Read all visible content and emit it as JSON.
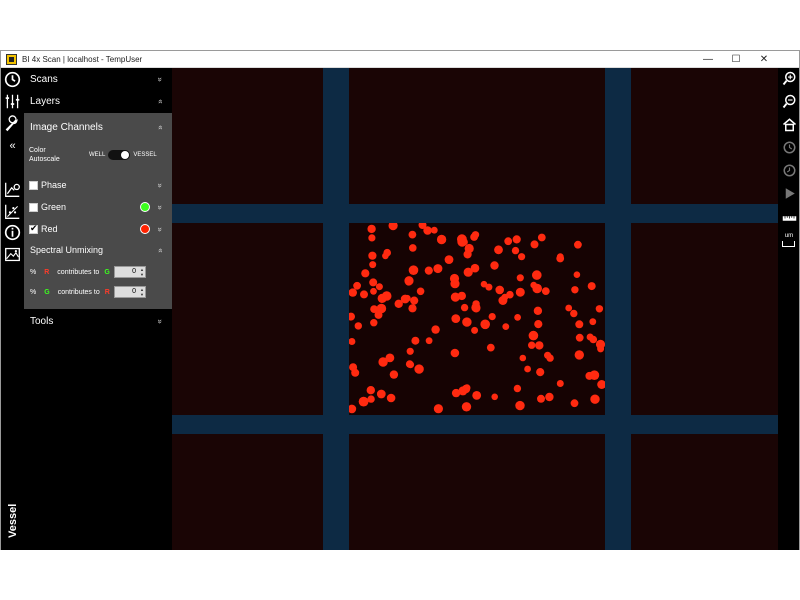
{
  "window": {
    "title": "BI 4x Scan | localhost - TempUser",
    "minimize": "—",
    "maximize": "☐",
    "close": "✕"
  },
  "left_rail": {
    "icons": [
      "clock-icon",
      "sliders-icon",
      "wrench-icon",
      "collapse-icon",
      "graph-settings-icon",
      "scatter-icon",
      "info-icon",
      "image-icon"
    ],
    "collapse_glyph": "«",
    "vessel_label": "Vessel"
  },
  "sidebar": {
    "scans": {
      "label": "Scans",
      "chevron": "»"
    },
    "layers": {
      "label": "Layers",
      "chevron": "»"
    },
    "image_channels": {
      "label": "Image Channels",
      "chevron": "»",
      "color_autoscale_label": "Color Autoscale",
      "toggle_left": "WELL",
      "toggle_right": "VESSEL",
      "channels": [
        {
          "label": "Phase",
          "checked": false,
          "color": ""
        },
        {
          "label": "Green",
          "checked": false,
          "color": "#3cff1e"
        },
        {
          "label": "Red",
          "checked": true,
          "color": "#ff2200"
        }
      ]
    },
    "spectral_unmixing": {
      "label": "Spectral Unmixing",
      "chevron": "»",
      "rows": [
        {
          "pct": "%",
          "from": "R",
          "text": "contributes to",
          "to": "G",
          "value": "0"
        },
        {
          "pct": "%",
          "from": "G",
          "text": "contributes to",
          "to": "R",
          "value": "0"
        }
      ]
    },
    "tools": {
      "label": "Tools",
      "chevron": "»"
    }
  },
  "right_rail": {
    "icons": [
      "zoom-in-icon",
      "zoom-out-icon",
      "home-icon",
      "history-forward-icon",
      "history-back-icon",
      "play-icon",
      "ruler-icon"
    ],
    "unit_label": "um"
  },
  "colors": {
    "background": "#000000",
    "panel": "#4a4a4a",
    "gap": "#0d2a44",
    "tile": "#1a0505",
    "cell": "#ff2a10"
  }
}
